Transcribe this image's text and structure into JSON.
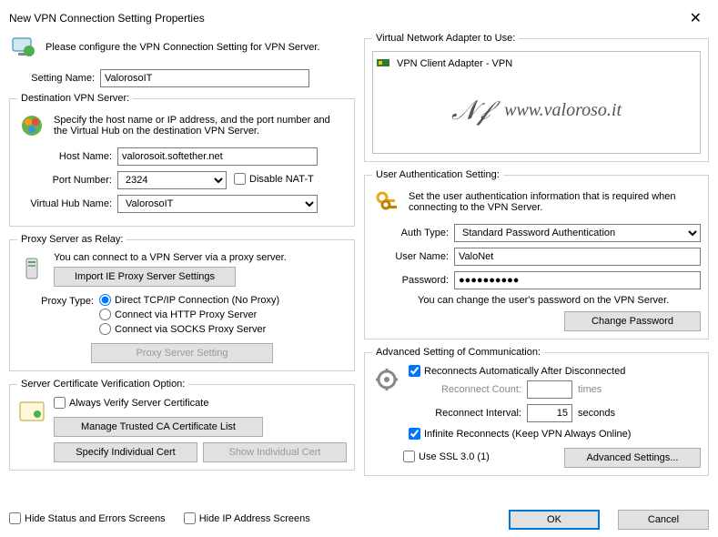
{
  "window": {
    "title": "New VPN Connection Setting Properties"
  },
  "intro": "Please configure the VPN Connection Setting for VPN Server.",
  "setting_name_label": "Setting Name:",
  "setting_name_value": "ValorosoIT",
  "dest": {
    "legend": "Destination VPN Server:",
    "desc": "Specify the host name or IP address, and the port number and the Virtual Hub on the destination VPN Server.",
    "host_label": "Host Name:",
    "host_value": "valorosoit.softether.net",
    "port_label": "Port Number:",
    "port_value": "2324",
    "disable_nat": "Disable NAT-T",
    "hub_label": "Virtual Hub Name:",
    "hub_value": "ValorosoIT"
  },
  "proxy": {
    "legend": "Proxy Server as Relay:",
    "desc": "You can connect to a VPN Server via a proxy server.",
    "import_btn": "Import IE Proxy Server Settings",
    "type_label": "Proxy Type:",
    "opt_direct": "Direct TCP/IP Connection (No Proxy)",
    "opt_http": "Connect via HTTP Proxy Server",
    "opt_socks": "Connect via SOCKS Proxy Server",
    "setting_btn": "Proxy Server Setting"
  },
  "cert": {
    "legend": "Server Certificate Verification Option:",
    "always": "Always Verify Server Certificate",
    "manage_btn": "Manage Trusted CA Certificate List",
    "specify_btn": "Specify Individual Cert",
    "show_btn": "Show Individual Cert"
  },
  "adapter": {
    "legend": "Virtual Network Adapter to Use:",
    "item": "VPN Client Adapter - VPN",
    "logo_text": "www.valoroso.it"
  },
  "auth": {
    "legend": "User Authentication Setting:",
    "desc": "Set the user authentication information that is required when connecting to the VPN Server.",
    "type_label": "Auth Type:",
    "type_value": "Standard Password Authentication",
    "user_label": "User Name:",
    "user_value": "ValoNet",
    "pass_label": "Password:",
    "pass_value": "●●●●●●●●●●",
    "pass_hint": "You can change the user's password on the VPN Server.",
    "change_btn": "Change Password"
  },
  "adv": {
    "legend": "Advanced Setting of Communication:",
    "reconnect": "Reconnects Automatically After Disconnected",
    "count_label": "Reconnect Count:",
    "count_value": "",
    "count_unit": "times",
    "interval_label": "Reconnect Interval:",
    "interval_value": "15",
    "interval_unit": "seconds",
    "infinite": "Infinite Reconnects (Keep VPN Always Online)",
    "ssl": "Use SSL 3.0 (1)",
    "advanced_btn": "Advanced Settings..."
  },
  "bottom": {
    "hide_status": "Hide Status and Errors Screens",
    "hide_ip": "Hide IP Address Screens",
    "ok": "OK",
    "cancel": "Cancel"
  }
}
